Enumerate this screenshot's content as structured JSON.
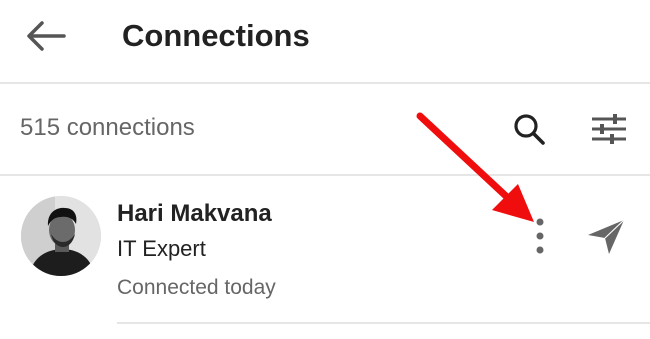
{
  "header": {
    "title": "Connections",
    "back_icon": "arrow-left-icon"
  },
  "toolbar": {
    "count_text": "515 connections",
    "search_icon": "search-icon",
    "filter_icon": "sliders-icon"
  },
  "connection": {
    "name": "Hari Makvana",
    "headline": "IT Expert",
    "connected_text": "Connected today",
    "more_icon": "more-vertical-icon",
    "send_icon": "send-icon"
  },
  "colors": {
    "annotation_red": "#ef0d0d",
    "text_primary": "#222222",
    "text_secondary": "#666666",
    "divider": "#e6e6e6",
    "icon_gray": "#666666"
  }
}
